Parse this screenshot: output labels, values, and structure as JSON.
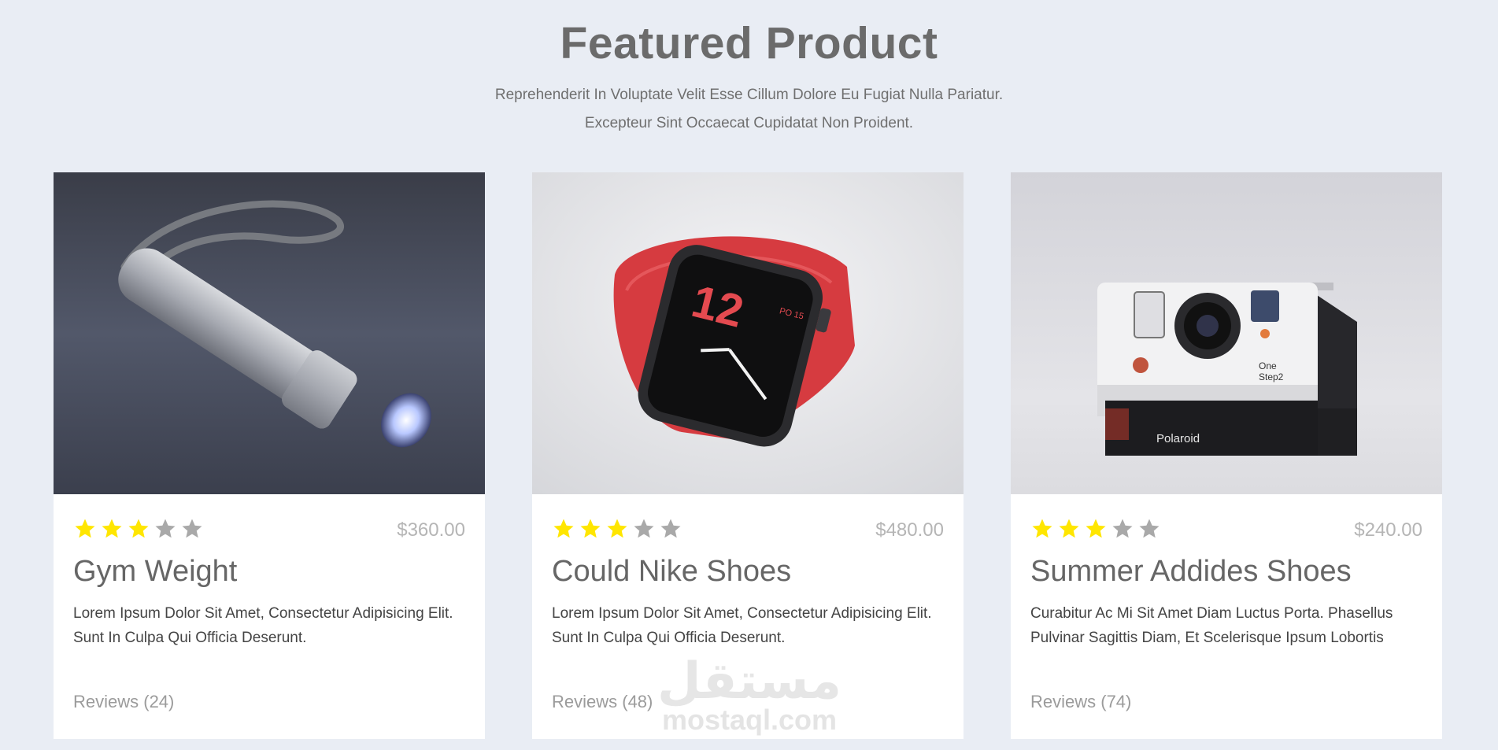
{
  "section": {
    "title": "Featured Product",
    "subtitle_line1": "Reprehenderit In Voluptate Velit Esse Cillum Dolore Eu Fugiat Nulla Pariatur.",
    "subtitle_line2": "Excepteur Sint Occaecat Cupidatat Non Proident."
  },
  "colors": {
    "star_filled": "#ffe600",
    "star_empty": "#a9a9a9",
    "background": "#e9edf4"
  },
  "products": [
    {
      "image_icon": "flashlight-image",
      "rating": 3,
      "rating_max": 5,
      "price": "$360.00",
      "name": "Gym Weight",
      "description": "Lorem Ipsum Dolor Sit Amet, Consectetur Adipisicing Elit. Sunt In Culpa Qui Officia Deserunt.",
      "reviews": "Reviews (24)"
    },
    {
      "image_icon": "smartwatch-image",
      "rating": 3,
      "rating_max": 5,
      "price": "$480.00",
      "name": "Could Nike Shoes",
      "description": "Lorem Ipsum Dolor Sit Amet, Consectetur Adipisicing Elit. Sunt In Culpa Qui Officia Deserunt.",
      "reviews": "Reviews (48)"
    },
    {
      "image_icon": "polaroid-camera-image",
      "rating": 3,
      "rating_max": 5,
      "price": "$240.00",
      "name": "Summer Addides Shoes",
      "description": "Curabitur Ac Mi Sit Amet Diam Luctus Porta. Phasellus Pulvinar Sagittis Diam, Et Scelerisque Ipsum Lobortis",
      "reviews": "Reviews (74)"
    }
  ],
  "watermark": {
    "arabic": "مستقل",
    "latin": "mostaql.com"
  }
}
